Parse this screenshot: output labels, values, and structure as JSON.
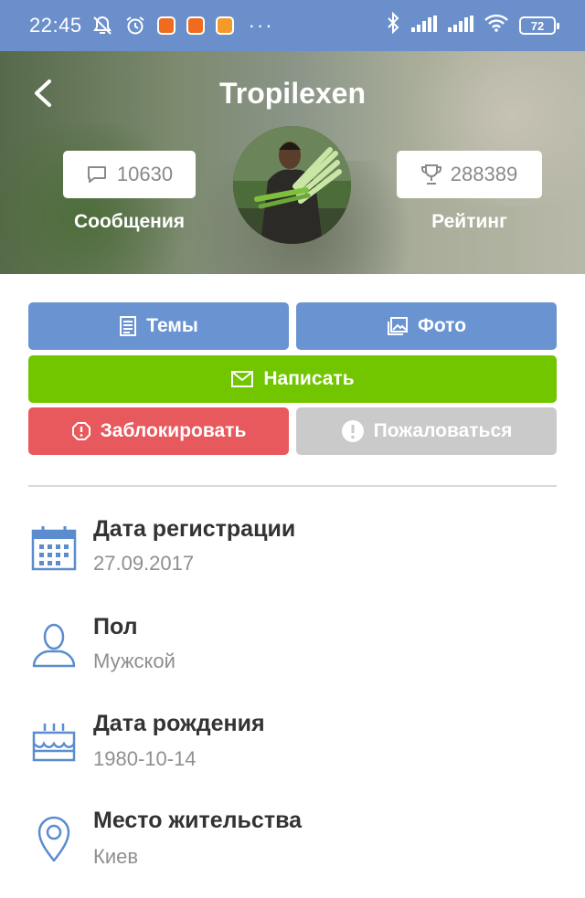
{
  "status_bar": {
    "time": "22:45",
    "battery": "72",
    "more": "···",
    "icons": [
      "mute-bell-icon",
      "alarm-icon",
      "app-icon-1",
      "app-icon-2",
      "app-icon-3",
      "bluetooth-icon",
      "signal-icon",
      "signal-icon",
      "wifi-icon",
      "battery-icon"
    ],
    "bg_color": "#6b8fcb"
  },
  "profile": {
    "username": "Tropilexen",
    "messages_count": "10630",
    "messages_label": "Сообщения",
    "rating_count": "288389",
    "rating_label": "Рейтинг"
  },
  "actions": {
    "topics": "Темы",
    "photo": "Фото",
    "write": "Написать",
    "block": "Заблокировать",
    "report": "Пожаловаться",
    "colors": {
      "primary": "#6a93d2",
      "write": "#72c600",
      "block": "#e8595e",
      "report": "#cacaca"
    }
  },
  "info": {
    "registration_title": "Дата регистрации",
    "registration_value": "27.09.2017",
    "gender_title": "Пол",
    "gender_value": "Мужской",
    "birthday_title": "Дата рождения",
    "birthday_value": "1980-10-14",
    "location_title": "Место жительства",
    "location_value": "Киев"
  }
}
